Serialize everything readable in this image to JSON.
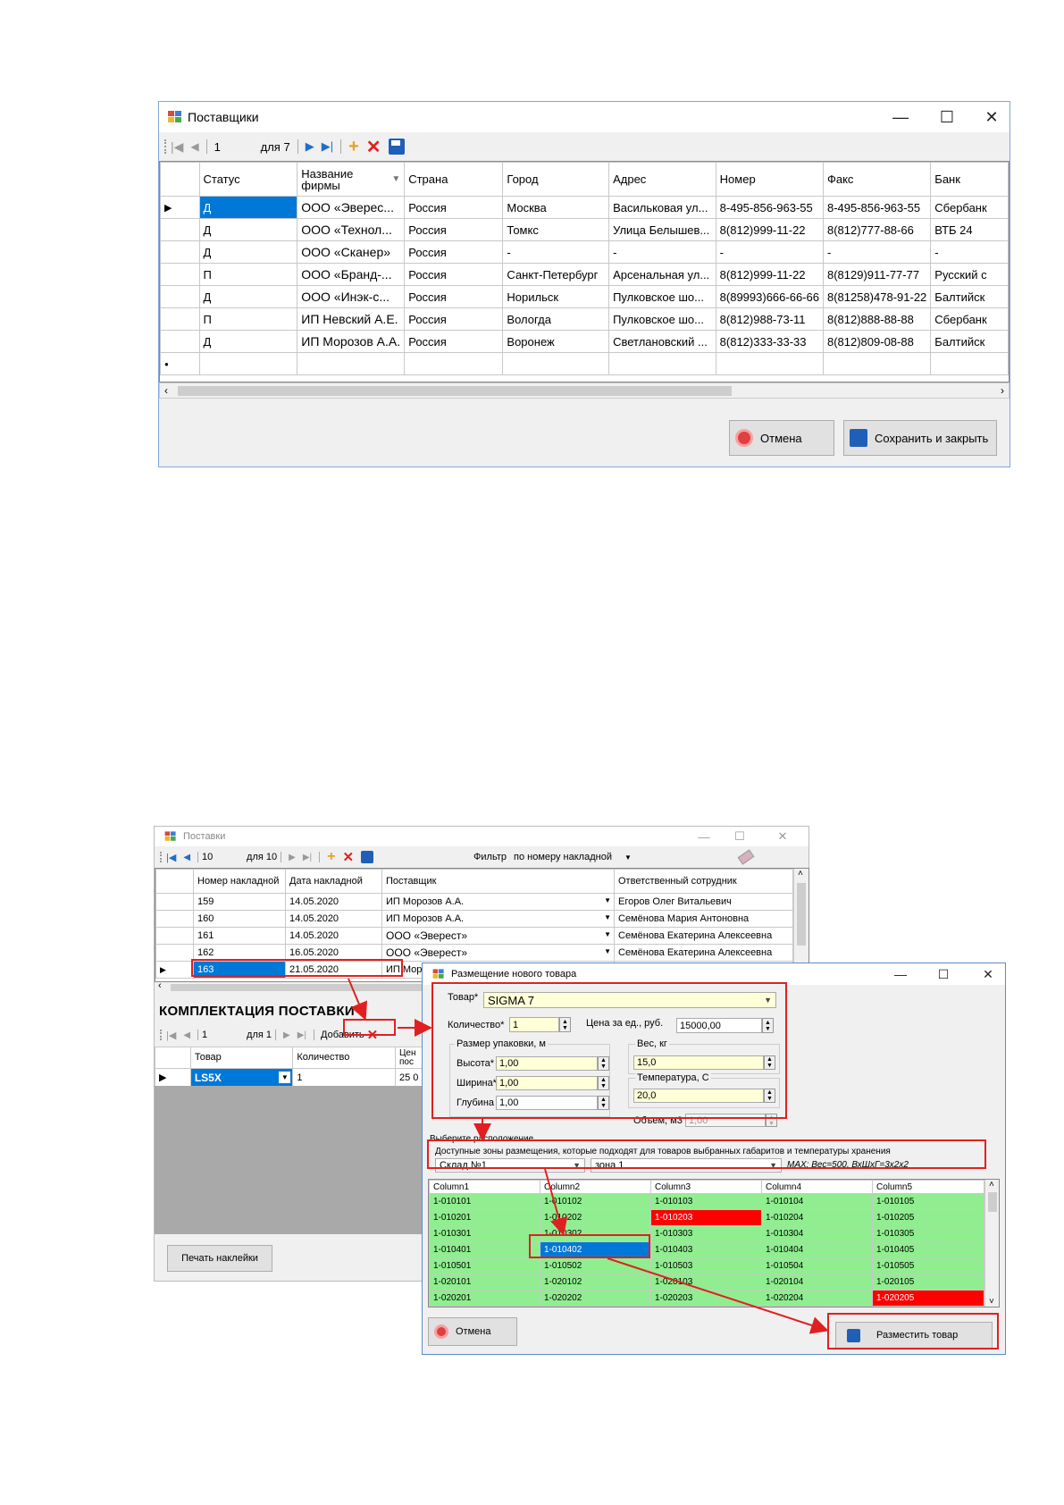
{
  "suppliers": {
    "title": "Поставщики",
    "nav": {
      "position": "1",
      "of": "для 7"
    },
    "columns": [
      "Статус",
      "Название фирмы",
      "Страна",
      "Город",
      "Адрес",
      "Номер",
      "Факс",
      "Банк"
    ],
    "rows": [
      [
        "Д",
        "ООО «Эверес...",
        "Россия",
        "Москва",
        "Васильковая ул...",
        "8-495-856-963-55",
        "8-495-856-963-55",
        "Сбербанк"
      ],
      [
        "Д",
        "ООО «Технол...",
        "Россия",
        "Томкс",
        "Улица Белышев...",
        "8(812)999-11-22",
        "8(812)777-88-66",
        "ВТБ 24"
      ],
      [
        "Д",
        "ООО «Сканер»",
        "Россия",
        "-",
        "-",
        "-",
        "-",
        "-"
      ],
      [
        "П",
        "ООО «Бранд-...",
        "Россия",
        "Санкт-Петербург",
        "Арсенальная ул...",
        "8(812)999-11-22",
        "8(8129)911-77-77",
        "Русский с"
      ],
      [
        "Д",
        "ООО «Инэк-с...",
        "Россия",
        "Норильск",
        "Пулковское шо...",
        "8(89993)666-66-66",
        "8(81258)478-91-22",
        "Балтийск"
      ],
      [
        "П",
        "ИП Невский А.Е.",
        "Россия",
        "Вологда",
        "Пулковское шо...",
        "8(812)988-73-11",
        "8(812)888-88-88",
        "Сбербанк"
      ],
      [
        "Д",
        "ИП Морозов А.А.",
        "Россия",
        "Воронеж",
        "Светлановский ...",
        "8(812)333-33-33",
        "8(812)809-08-88",
        "Балтийск"
      ]
    ],
    "cancel_label": "Отмена",
    "save_close_label": "Сохранить и закрыть"
  },
  "deliveries": {
    "title": "Поставки",
    "nav": {
      "position": "10",
      "of": "для 10"
    },
    "filter_label": "Фильтр",
    "filter_value": "по номеру накладной",
    "columns": [
      "Номер накладной",
      "Дата накладной",
      "Поставщик",
      "Ответственный сотрудник"
    ],
    "rows": [
      [
        "159",
        "14.05.2020",
        "ИП Морозов А.А.",
        "Егоров Олег Витальевич"
      ],
      [
        "160",
        "14.05.2020",
        "ИП Морозов А.А.",
        "Семёнова Мария Антоновна"
      ],
      [
        "161",
        "14.05.2020",
        "ООО «Эверест»",
        "Семёнова Екатерина Алексеевна"
      ],
      [
        "162",
        "16.05.2020",
        "ООО «Эверест»",
        "Семёнова Екатерина Алексеевна"
      ],
      [
        "163",
        "21.05.2020",
        "ИП Мор",
        ""
      ]
    ],
    "section_title": "КОМПЛЕКТАЦИЯ ПОСТАВКИ",
    "items_nav": {
      "position": "1",
      "of": "для 1"
    },
    "add_label": "Добавить",
    "item_columns": [
      "Товар",
      "Количество",
      "Цен пос"
    ],
    "item_rows": [
      [
        "LS5X",
        "1",
        "25 0"
      ]
    ],
    "print_label": "Печать наклейки"
  },
  "placement": {
    "title": "Размещение нового товара",
    "product_label": "Товар*",
    "product_value": "SIGMA 7",
    "qty_label": "Количество*",
    "qty_value": "1",
    "price_label": "Цена за ед., руб.",
    "price_value": "15000,00",
    "pack_size_label": "Размер упаковки, м",
    "height_label": "Высота*",
    "height_value": "1,00",
    "width_label": "Ширина*",
    "width_value": "1,00",
    "depth_label": "Глубина",
    "depth_value": "1,00",
    "weight_label": "Вес, кг",
    "weight_value": "15,0",
    "temp_label": "Температура, С",
    "temp_value": "20,0",
    "volume_label": "Объем, м3",
    "volume_value": "1,00",
    "location_label": "Выберите расположение",
    "zones_label": "Доступные зоны размещения, которые подходят для товаров выбранных габаритов и температуры хранения",
    "warehouse_value": "Склад №1",
    "zone_value": "зона 1",
    "max_info": "MAX: Вес=500, ВхШхГ=3х2х2",
    "cell_columns": [
      "Column1",
      "Column2",
      "Column3",
      "Column4",
      "Column5"
    ],
    "cell_rows": [
      [
        "1-010101",
        "1-010102",
        "1-010103",
        "1-010104",
        "1-010105"
      ],
      [
        "1-010201",
        "1-010202",
        "1-010203",
        "1-010204",
        "1-010205"
      ],
      [
        "1-010301",
        "1-010302",
        "1-010303",
        "1-010304",
        "1-010305"
      ],
      [
        "1-010401",
        "1-010402",
        "1-010403",
        "1-010404",
        "1-010405"
      ],
      [
        "1-010501",
        "1-010502",
        "1-010503",
        "1-010504",
        "1-010505"
      ],
      [
        "1-020101",
        "1-020102",
        "1-020103",
        "1-020104",
        "1-020105"
      ],
      [
        "1-020201",
        "1-020202",
        "1-020203",
        "1-020204",
        "1-020205"
      ]
    ],
    "occupied_cells": [
      "1-010203",
      "1-020205"
    ],
    "selected_cell": "1-010402",
    "cancel_label": "Отмена",
    "place_label": "Разместить товар"
  },
  "colors": {
    "selection": "#0078d7",
    "free_cell": "#90ee90",
    "occupied_cell": "#ff0000",
    "annotation": "#e02020"
  }
}
